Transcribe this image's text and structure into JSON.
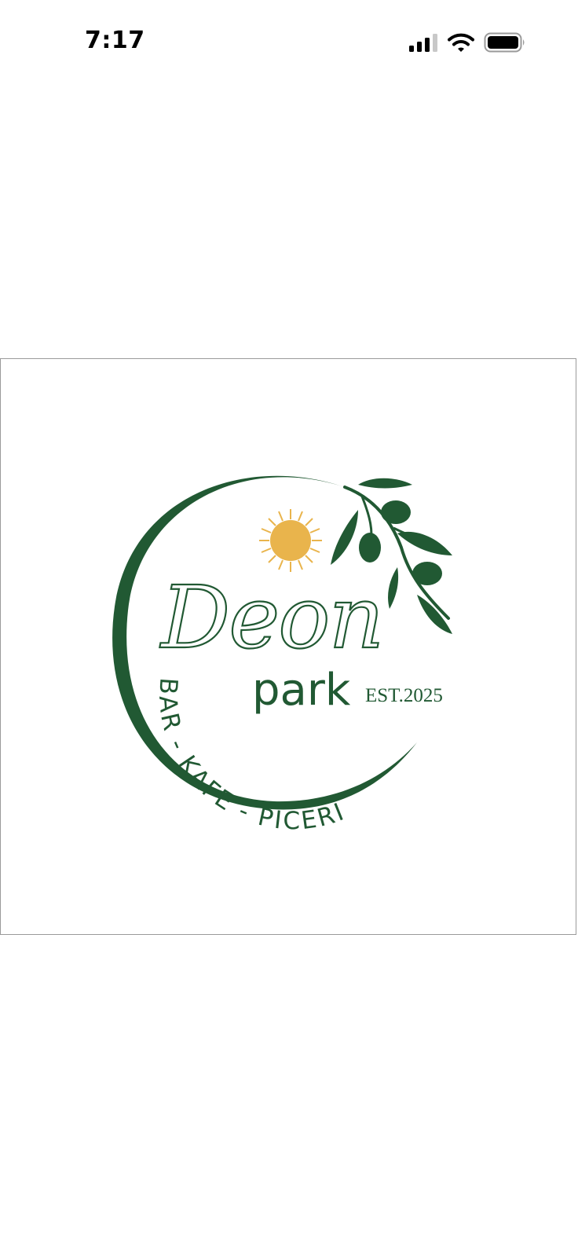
{
  "status_bar": {
    "time": "7:17",
    "icons": [
      "cellular-signal-icon",
      "wifi-icon",
      "battery-icon"
    ]
  },
  "logo": {
    "name_script": "Deon",
    "name_sub": "park",
    "established": "EST.2025",
    "tagline": "BAR - KAFE - PICERI",
    "colors": {
      "brand_green": "#215933",
      "sun_yellow": "#E9B44C"
    }
  }
}
